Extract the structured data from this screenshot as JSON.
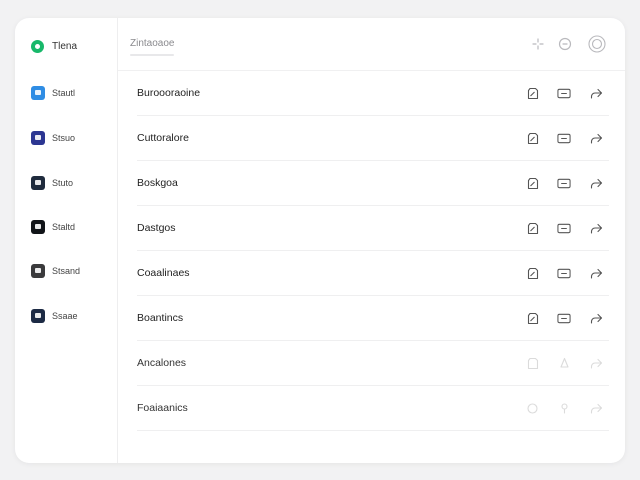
{
  "brand": {
    "label": "Tlena",
    "color": "#18b86a"
  },
  "sidebar": {
    "items": [
      {
        "label": "Stautl",
        "icon": "square-app-icon",
        "color": "#2f8de4"
      },
      {
        "label": "Stsuo",
        "icon": "square-app-icon",
        "color": "#2c3692"
      },
      {
        "label": "Stuto",
        "icon": "square-app-icon",
        "color": "#1f2b3d"
      },
      {
        "label": "Staltd",
        "icon": "square-app-icon",
        "color": "#111418"
      },
      {
        "label": "Stsand",
        "icon": "square-app-icon",
        "color": "#3a3a3c"
      },
      {
        "label": "Ssaae",
        "icon": "square-app-icon",
        "color": "#1c2a44"
      }
    ]
  },
  "header": {
    "title": "Zintaoaoe",
    "icons": [
      "move-icon",
      "info-circle-icon",
      "user-circle-icon"
    ]
  },
  "rows": [
    {
      "label": "Buroooraoine"
    },
    {
      "label": "Cuttoralore"
    },
    {
      "label": "Boskgoa"
    },
    {
      "label": "Dastgos"
    },
    {
      "label": "Coaalinaes"
    },
    {
      "label": "Boantincs"
    },
    {
      "label": "Ancalones"
    },
    {
      "label": "Foaiaanics"
    }
  ],
  "row_actions": [
    "edit-icon",
    "message-icon",
    "share-icon"
  ]
}
